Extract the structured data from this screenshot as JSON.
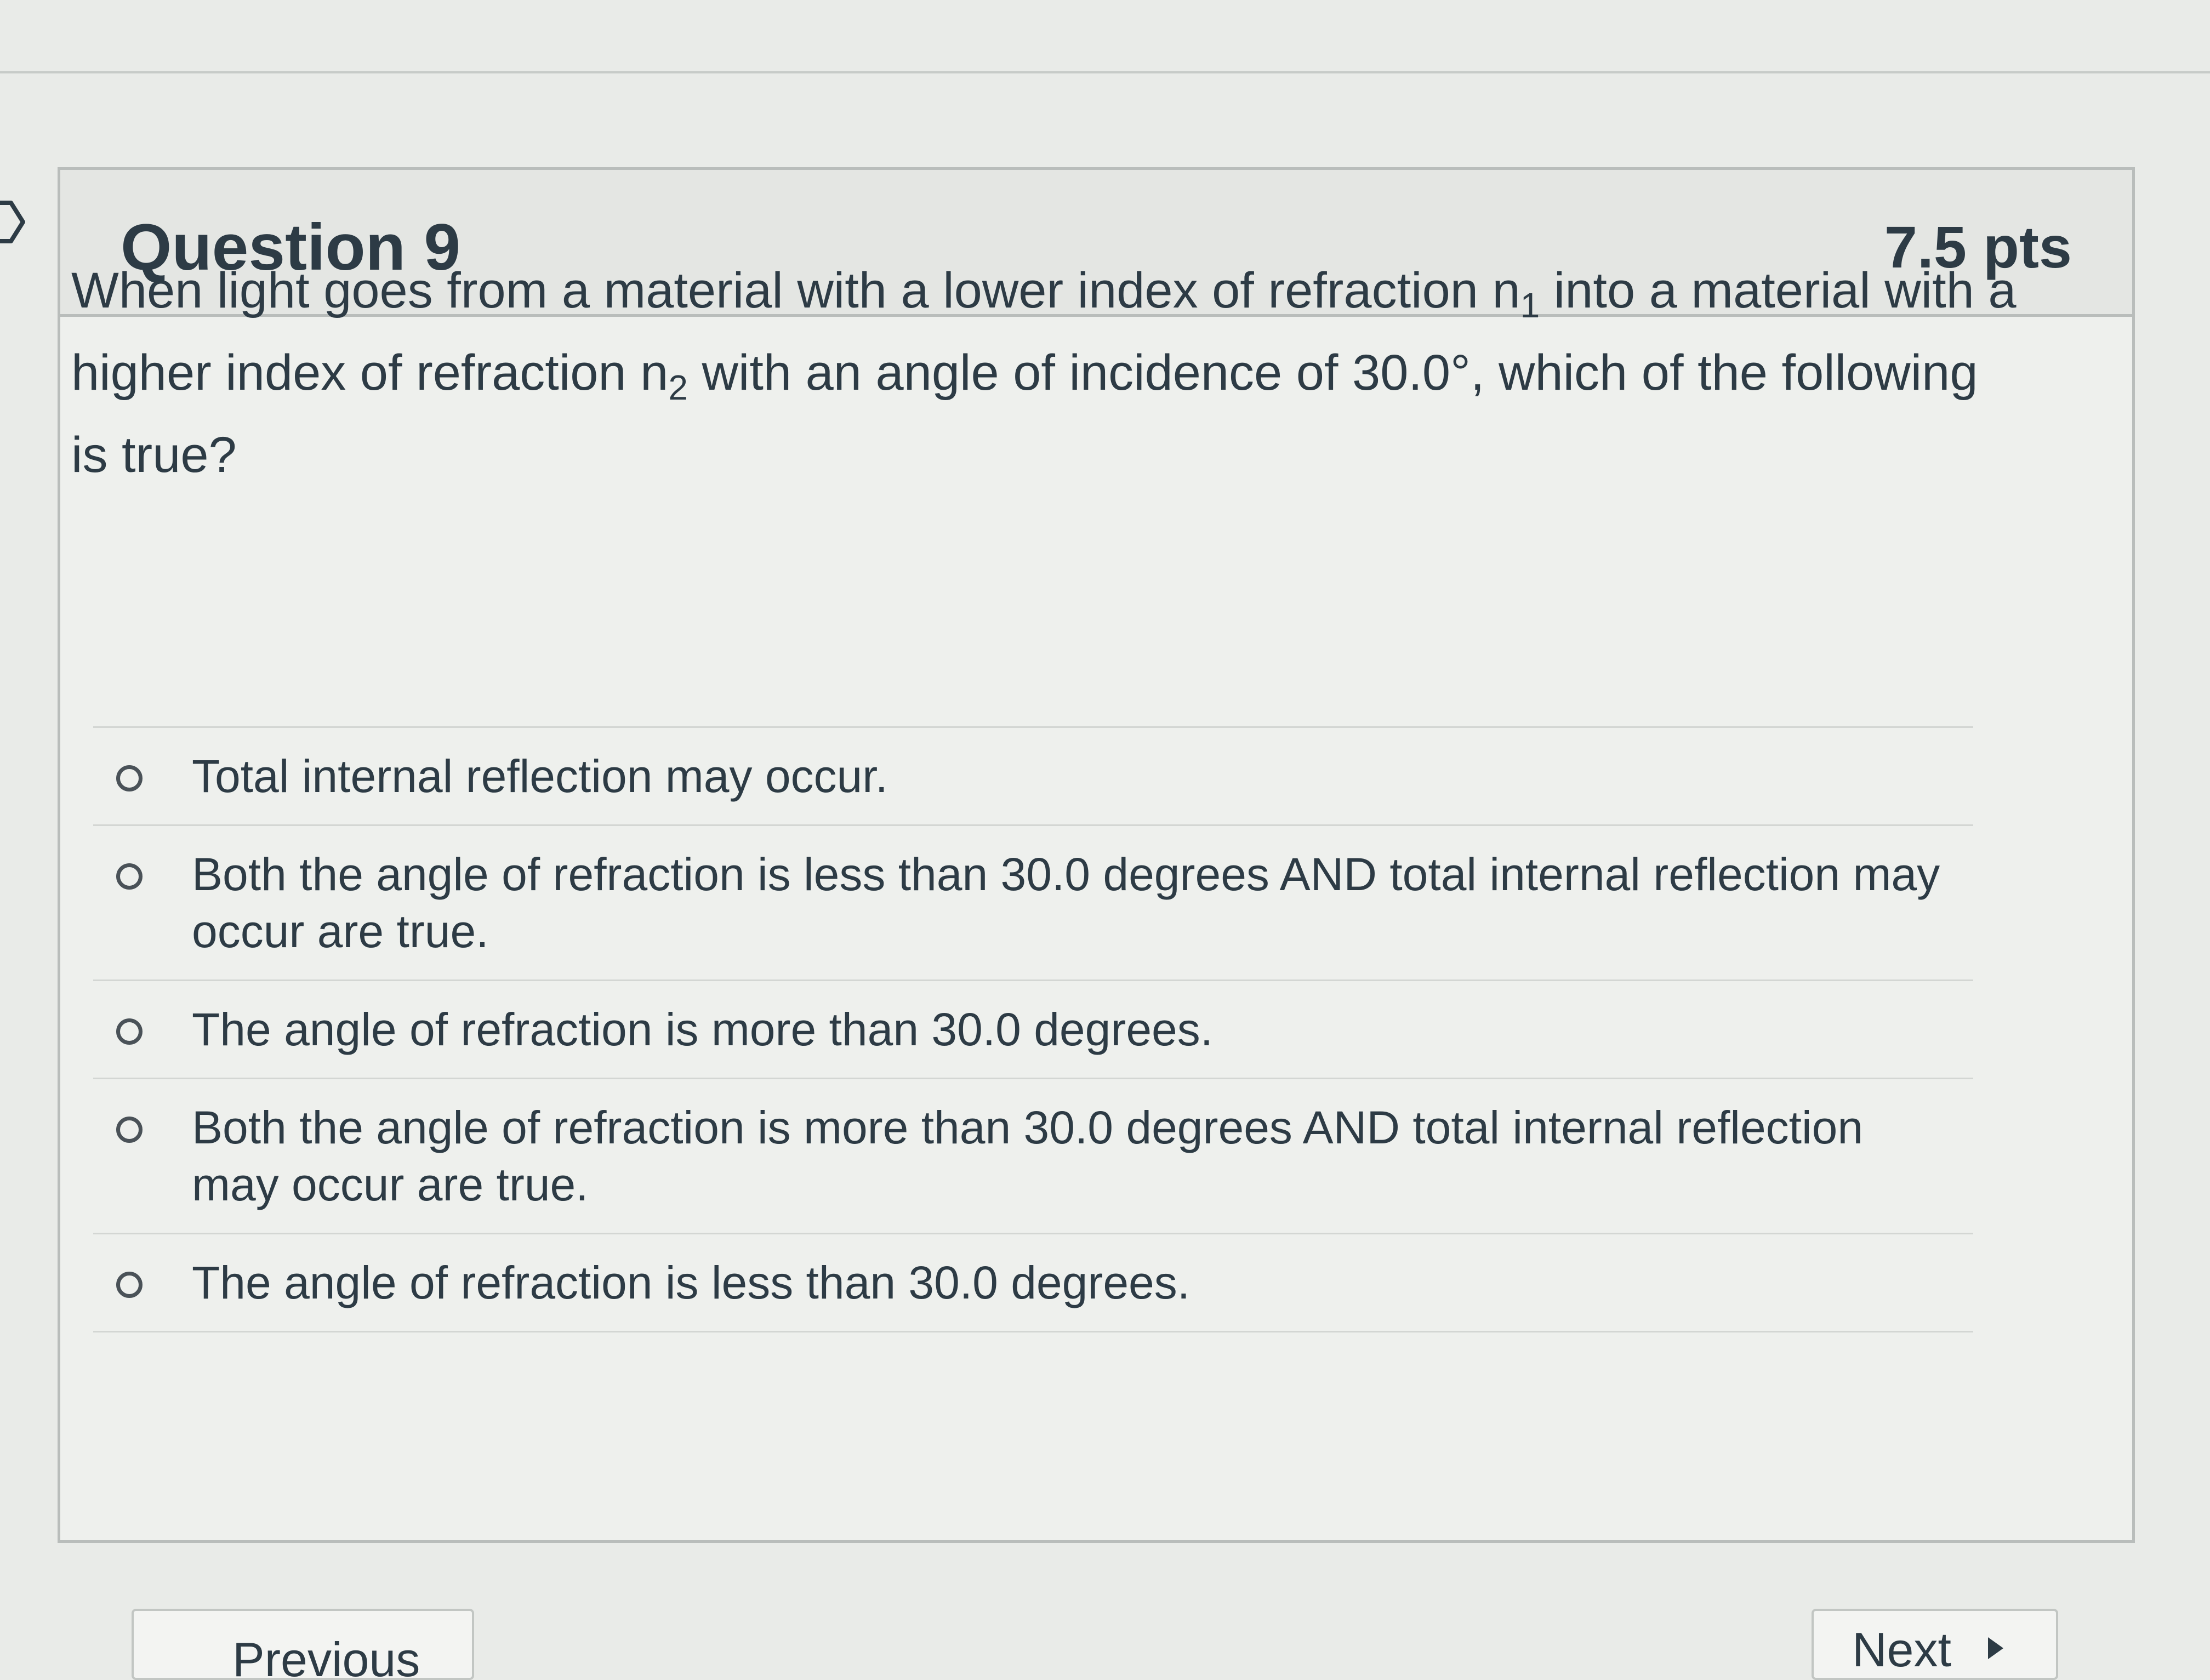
{
  "question": {
    "title": "Question 9",
    "points": "7.5 pts",
    "text_part1": "When light goes from a material with a lower index of refraction n",
    "sub1": "1",
    "text_part2": " into a material with a higher index of refraction n",
    "sub2": "2",
    "text_part3": " with an angle of incidence of 30.0°, which of the following is true?"
  },
  "answers": [
    "Total internal reflection may occur.",
    "Both the angle of refraction is less than 30.0 degrees AND total internal reflection may occur are true.",
    "The angle of refraction is more than 30.0 degrees.",
    "Both the angle of refraction is more than 30.0 degrees AND total internal reflection may occur are true.",
    "The angle of refraction is less than 30.0 degrees."
  ],
  "navigation": {
    "previous_label": "Previous",
    "next_label": "Next"
  },
  "colors": {
    "page_background": "#e9ebe8",
    "header_background": "#e4e6e3",
    "text": "#2d3b45",
    "border": "#b9bdbb"
  },
  "icons": {
    "flag": "flag-icon",
    "radio": "radio-circle",
    "next": "caret-right-icon"
  }
}
